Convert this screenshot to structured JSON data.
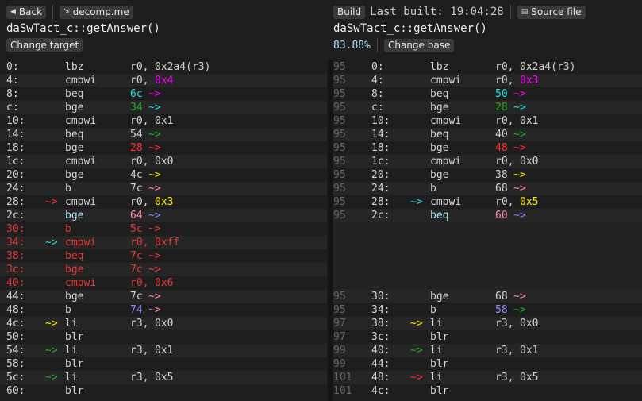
{
  "left": {
    "back_label": "Back",
    "site_label": "decomp.me",
    "function_name": "daSwTact_c::getAnswer()",
    "change_label": "Change target"
  },
  "right": {
    "build_label": "Build",
    "last_built": "Last built: 19:04:28",
    "source_label": "Source file",
    "function_name": "daSwTact_c::getAnswer()",
    "match_percent": "83.88%",
    "change_label": "Change base"
  },
  "colors": {
    "background": "#1e1e1e",
    "diff_red": "#e53935",
    "magenta": "#ff00ff",
    "cyan": "#1fe0e0",
    "green": "#22b022",
    "yellow": "#ffea00",
    "purple": "#8d87ff",
    "pink": "#ff8aa8"
  },
  "target_lines": [
    {
      "addr": "0:",
      "arrow": "",
      "op": "lbz",
      "a1": "r0,",
      "a2": "0x2a4(r3)",
      "ac": "white",
      "tail": "",
      "state": ""
    },
    {
      "addr": "4:",
      "arrow": "",
      "op": "cmpwi",
      "a1": "r0,",
      "a2": "0x4",
      "ac": "magenta",
      "tail": "",
      "state": ""
    },
    {
      "addr": "8:",
      "arrow": "",
      "op": "beq",
      "a1": "6c",
      "ac1": "cyan",
      "a2": "~>",
      "ac": "magenta",
      "tail": "",
      "state": ""
    },
    {
      "addr": "c:",
      "arrow": "",
      "op": "bge",
      "a1": "34",
      "ac1": "green",
      "a2": "~>",
      "ac": "cyan",
      "tail": "",
      "state": ""
    },
    {
      "addr": "10:",
      "arrow": "",
      "op": "cmpwi",
      "a1": "r0,",
      "a2": "0x1",
      "ac": "white",
      "tail": "",
      "state": ""
    },
    {
      "addr": "14:",
      "arrow": "",
      "op": "beq",
      "a1": "54",
      "a2": "~>",
      "ac": "green",
      "tail": "",
      "state": ""
    },
    {
      "addr": "18:",
      "arrow": "",
      "op": "bge",
      "a1": "28",
      "ac1": "red",
      "a2": "~>",
      "ac": "red",
      "tail": "",
      "state": ""
    },
    {
      "addr": "1c:",
      "arrow": "",
      "op": "cmpwi",
      "a1": "r0,",
      "a2": "0x0",
      "ac": "white",
      "tail": "",
      "state": ""
    },
    {
      "addr": "20:",
      "arrow": "",
      "op": "bge",
      "a1": "4c",
      "a2": "~>",
      "ac": "yellow",
      "tail": "",
      "state": ""
    },
    {
      "addr": "24:",
      "arrow": "",
      "op": "b",
      "a1": "7c",
      "a2": "~>",
      "ac": "pink",
      "tail": "",
      "state": ""
    },
    {
      "addr": "28:",
      "arrow": "~>",
      "arc": "red",
      "op": "cmpwi",
      "a1": "r0,",
      "a2": "0x3",
      "ac": "yellow",
      "tail": "",
      "state": ""
    },
    {
      "addr": "2c:",
      "arrow": "",
      "op": "bge",
      "opc": "light",
      "a1": "64",
      "ac1": "pink",
      "a2": "~>",
      "ac": "purple",
      "tail": "",
      "state": ""
    },
    {
      "addr": "30:",
      "arrow": "",
      "op": "b",
      "a1": "5c",
      "a2": "~>",
      "ac": "green",
      "tail": "",
      "state": "diff"
    },
    {
      "addr": "34:",
      "arrow": "~>",
      "arc": "cyan",
      "op": "cmpwi",
      "a1": "r0,",
      "a2": "0xff",
      "ac": "",
      "tail": "",
      "state": "diff"
    },
    {
      "addr": "38:",
      "arrow": "",
      "op": "beq",
      "a1": "7c",
      "a2": "~>",
      "ac": "pink",
      "tail": "",
      "state": "diff"
    },
    {
      "addr": "3c:",
      "arrow": "",
      "op": "bge",
      "a1": "7c",
      "a2": "~>",
      "ac": "pink",
      "tail": "",
      "state": "diff"
    },
    {
      "addr": "40:",
      "arrow": "",
      "op": "cmpwi",
      "a1": "r0,",
      "a2": "0x6",
      "ac": "",
      "tail": "",
      "state": "diff"
    },
    {
      "addr": "44:",
      "arrow": "",
      "op": "bge",
      "a1": "7c",
      "a2": "~>",
      "ac": "pink",
      "tail": "",
      "state": ""
    },
    {
      "addr": "48:",
      "arrow": "",
      "op": "b",
      "a1": "74",
      "ac1": "purple",
      "a2": "~>",
      "ac": "pink",
      "tail": "",
      "state": ""
    },
    {
      "addr": "4c:",
      "arrow": "~>",
      "arc": "yellow",
      "op": "li",
      "a1": "r3,",
      "a2": "0x0",
      "ac": "white",
      "tail": "",
      "state": ""
    },
    {
      "addr": "50:",
      "arrow": "",
      "op": "blr",
      "a1": "",
      "a2": "",
      "ac": "white",
      "tail": "",
      "state": ""
    },
    {
      "addr": "54:",
      "arrow": "~>",
      "arc": "green",
      "op": "li",
      "a1": "r3,",
      "a2": "0x1",
      "ac": "white",
      "tail": "",
      "state": ""
    },
    {
      "addr": "58:",
      "arrow": "",
      "op": "blr",
      "a1": "",
      "a2": "",
      "ac": "white",
      "tail": "",
      "state": ""
    },
    {
      "addr": "5c:",
      "arrow": "~>",
      "arc": "green",
      "op": "li",
      "a1": "r3,",
      "a2": "0x5",
      "ac": "white",
      "tail": "",
      "state": ""
    },
    {
      "addr": "60:",
      "arrow": "",
      "op": "blr",
      "a1": "",
      "a2": "",
      "ac": "white",
      "tail": "",
      "state": ""
    }
  ],
  "base_lines": [
    {
      "line": "95",
      "addr": "0:",
      "arrow": "",
      "op": "lbz",
      "a1": "r0,",
      "a2": "0x2a4(r3)",
      "ac": "white"
    },
    {
      "line": "95",
      "addr": "4:",
      "arrow": "",
      "op": "cmpwi",
      "a1": "r0,",
      "a2": "0x3",
      "ac": "magenta"
    },
    {
      "line": "95",
      "addr": "8:",
      "arrow": "",
      "op": "beq",
      "a1": "50",
      "ac1": "cyan",
      "a2": "~>",
      "ac": "magenta"
    },
    {
      "line": "95",
      "addr": "c:",
      "arrow": "",
      "op": "bge",
      "a1": "28",
      "ac1": "green",
      "a2": "~>",
      "ac": "cyan"
    },
    {
      "line": "95",
      "addr": "10:",
      "arrow": "",
      "op": "cmpwi",
      "a1": "r0,",
      "a2": "0x1",
      "ac": "white"
    },
    {
      "line": "95",
      "addr": "14:",
      "arrow": "",
      "op": "beq",
      "a1": "40",
      "a2": "~>",
      "ac": "green"
    },
    {
      "line": "95",
      "addr": "18:",
      "arrow": "",
      "op": "bge",
      "a1": "48",
      "ac1": "red",
      "a2": "~>",
      "ac": "red"
    },
    {
      "line": "95",
      "addr": "1c:",
      "arrow": "",
      "op": "cmpwi",
      "a1": "r0,",
      "a2": "0x0",
      "ac": "white"
    },
    {
      "line": "95",
      "addr": "20:",
      "arrow": "",
      "op": "bge",
      "a1": "38",
      "a2": "~>",
      "ac": "yellow"
    },
    {
      "line": "95",
      "addr": "24:",
      "arrow": "",
      "op": "b",
      "a1": "68",
      "a2": "~>",
      "ac": "pink"
    },
    {
      "line": "95",
      "addr": "28:",
      "arrow": "~>",
      "arc": "cyan",
      "op": "cmpwi",
      "a1": "r0,",
      "a2": "0x5",
      "ac": "yellow"
    },
    {
      "line": "95",
      "addr": "2c:",
      "arrow": "",
      "op": "beq",
      "opc": "light",
      "a1": "60",
      "ac1": "pink",
      "a2": "~>",
      "ac": "purple"
    },
    {
      "empty": true
    },
    {
      "empty": true
    },
    {
      "empty": true
    },
    {
      "empty": true
    },
    {
      "empty": true
    },
    {
      "line": "95",
      "addr": "30:",
      "arrow": "",
      "op": "bge",
      "a1": "68",
      "a2": "~>",
      "ac": "pink"
    },
    {
      "line": "95",
      "addr": "34:",
      "arrow": "",
      "op": "b",
      "a1": "58",
      "ac1": "purple",
      "a2": "~>",
      "ac": "green"
    },
    {
      "line": "97",
      "addr": "38:",
      "arrow": "~>",
      "arc": "yellow",
      "op": "li",
      "a1": "r3,",
      "a2": "0x0",
      "ac": "white"
    },
    {
      "line": "97",
      "addr": "3c:",
      "arrow": "",
      "op": "blr",
      "a1": "",
      "a2": "",
      "ac": "white"
    },
    {
      "line": "99",
      "addr": "40:",
      "arrow": "~>",
      "arc": "green",
      "op": "li",
      "a1": "r3,",
      "a2": "0x1",
      "ac": "white"
    },
    {
      "line": "99",
      "addr": "44:",
      "arrow": "",
      "op": "blr",
      "a1": "",
      "a2": "",
      "ac": "white"
    },
    {
      "line": "101",
      "addr": "48:",
      "arrow": "~>",
      "arc": "red",
      "op": "li",
      "a1": "r3,",
      "a2": "0x5",
      "ac": "white"
    },
    {
      "line": "101",
      "addr": "4c:",
      "arrow": "",
      "op": "blr",
      "a1": "",
      "a2": "",
      "ac": "white"
    }
  ]
}
